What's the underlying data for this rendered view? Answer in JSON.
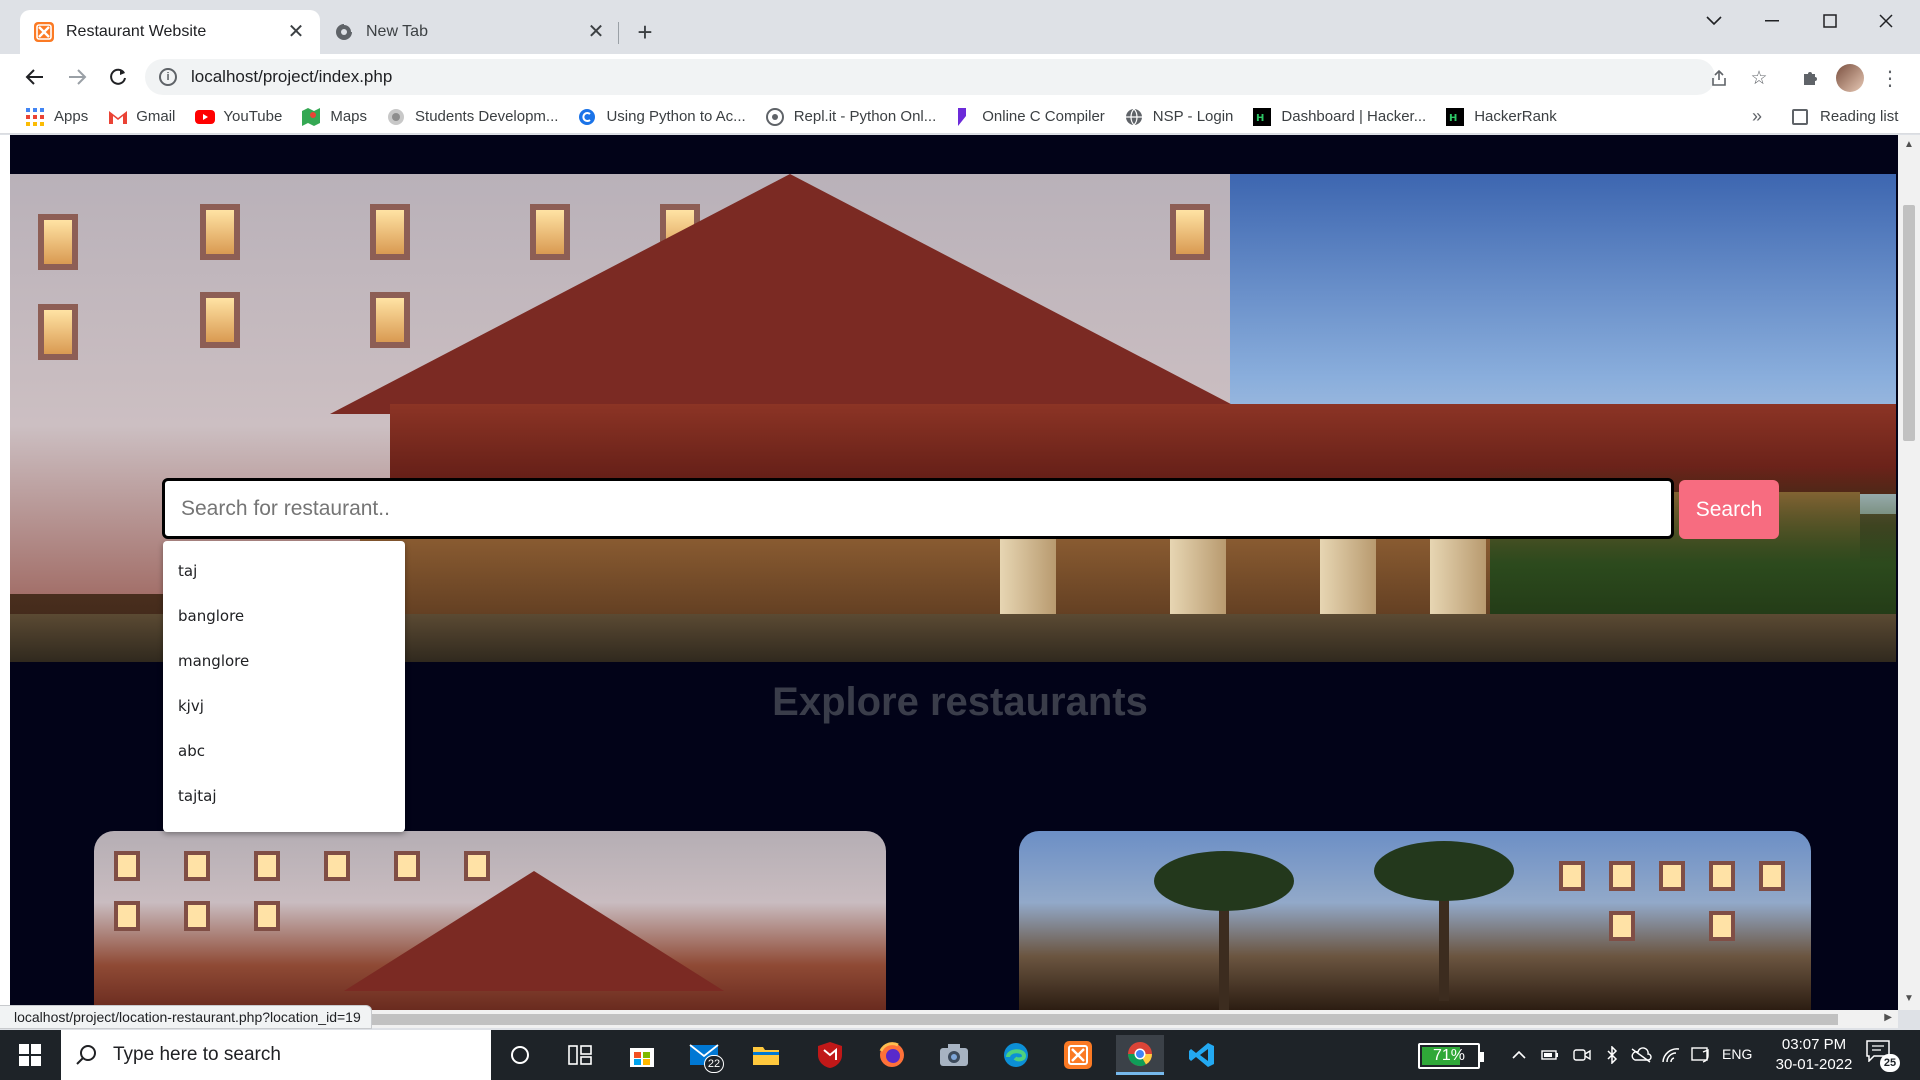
{
  "browser": {
    "tabs": [
      {
        "title": "Restaurant Website",
        "active": true,
        "favicon": "xampp-icon"
      },
      {
        "title": "New Tab",
        "active": false,
        "favicon": "chrome-globe-icon"
      }
    ],
    "new_tab_symbol": "+",
    "address": "localhost/project/index.php",
    "bookmarks": [
      {
        "label": "Apps",
        "icon": "apps-grid-icon",
        "color": "#4285f4"
      },
      {
        "label": "Gmail",
        "icon": "gmail-icon",
        "color": "#ea4335"
      },
      {
        "label": "YouTube",
        "icon": "youtube-icon",
        "color": "#ff0000"
      },
      {
        "label": "Maps",
        "icon": "maps-icon",
        "color": "#34a853"
      },
      {
        "label": "Students Developm...",
        "icon": "globe-icon",
        "color": "#9aa0a6"
      },
      {
        "label": "Using Python to Ac...",
        "icon": "course-icon",
        "color": "#1a73e8"
      },
      {
        "label": "Repl.it - Python Onl...",
        "icon": "replit-icon",
        "color": "#5f6368"
      },
      {
        "label": "Online C Compiler",
        "icon": "compiler-icon",
        "color": "#6c2bd9"
      },
      {
        "label": "NSP - Login",
        "icon": "globe-icon",
        "color": "#5f6368"
      },
      {
        "label": "Dashboard | Hacker...",
        "icon": "hackerrank-icon",
        "color": "#000000"
      },
      {
        "label": "HackerRank",
        "icon": "hackerrank-icon",
        "color": "#000000"
      }
    ],
    "bookmarks_overflow": "»",
    "reading_list": "Reading list",
    "status_url": "localhost/project/location-restaurant.php?location_id=19"
  },
  "page": {
    "search": {
      "placeholder": "Search for restaurant..",
      "button_label": "Search"
    },
    "suggestions": [
      "taj",
      "banglore",
      "manglore",
      "kjvj",
      "abc",
      "tajtaj"
    ],
    "section_title": "Explore restaurants",
    "colors": {
      "background": "#020318",
      "search_button": "#f76c80",
      "section_title": "#3a3d4a"
    }
  },
  "taskbar": {
    "search_placeholder": "Type here to search",
    "mail_badge": "22",
    "battery_percent": "71%",
    "battery_level": 0.71,
    "language": "ENG",
    "time": "03:07 PM",
    "date": "30-01-2022",
    "notification_count": "25"
  }
}
